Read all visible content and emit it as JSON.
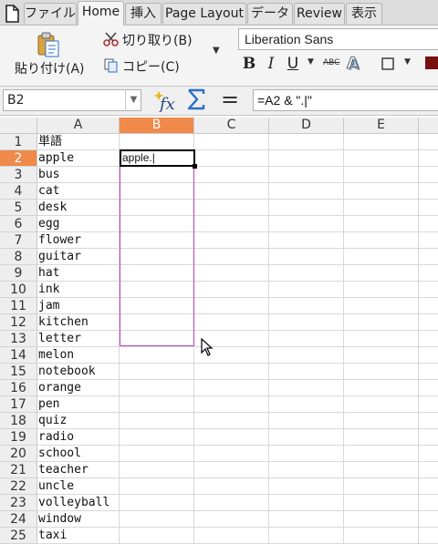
{
  "tabs": {
    "file": "ファイル",
    "home": "Home",
    "insert": "挿入",
    "page_layout": "Page Layout",
    "data": "データ",
    "review": "Review",
    "view": "表示"
  },
  "ribbon": {
    "paste": "貼り付け(A)",
    "cut": "切り取り(B)",
    "copy": "コピー(C)",
    "font_name": "Liberation Sans",
    "bold": "B",
    "italic": "I",
    "underline": "U",
    "strikethrough": "ABC"
  },
  "formula_bar": {
    "name_box": "B2",
    "formula": "=A2 & \".|\"",
    "equals": "="
  },
  "columns": [
    "A",
    "B",
    "C",
    "D",
    "E"
  ],
  "selected_column": "B",
  "rows": [
    "1",
    "2",
    "3",
    "4",
    "5",
    "6",
    "7",
    "8",
    "9",
    "10",
    "11",
    "12",
    "13",
    "14",
    "15",
    "16",
    "17",
    "18",
    "19",
    "20",
    "21",
    "22",
    "23",
    "24",
    "25"
  ],
  "selected_row": "2",
  "column_a": [
    "単語",
    "apple",
    "bus",
    "cat",
    "desk",
    "egg",
    "flower",
    "guitar",
    "hat",
    "ink",
    "jam",
    "kitchen",
    "letter",
    "melon",
    "notebook",
    "orange",
    "pen",
    "quiz",
    "radio",
    "school",
    "teacher",
    "uncle",
    "volleyball",
    "window",
    "taxi"
  ],
  "active_cell_value": "apple.|",
  "colors": {
    "selection_header": "#f08a4b",
    "range_border": "#c040c0",
    "icon_blue": "#2a6fc9",
    "paste_gold": "#d9a441"
  }
}
